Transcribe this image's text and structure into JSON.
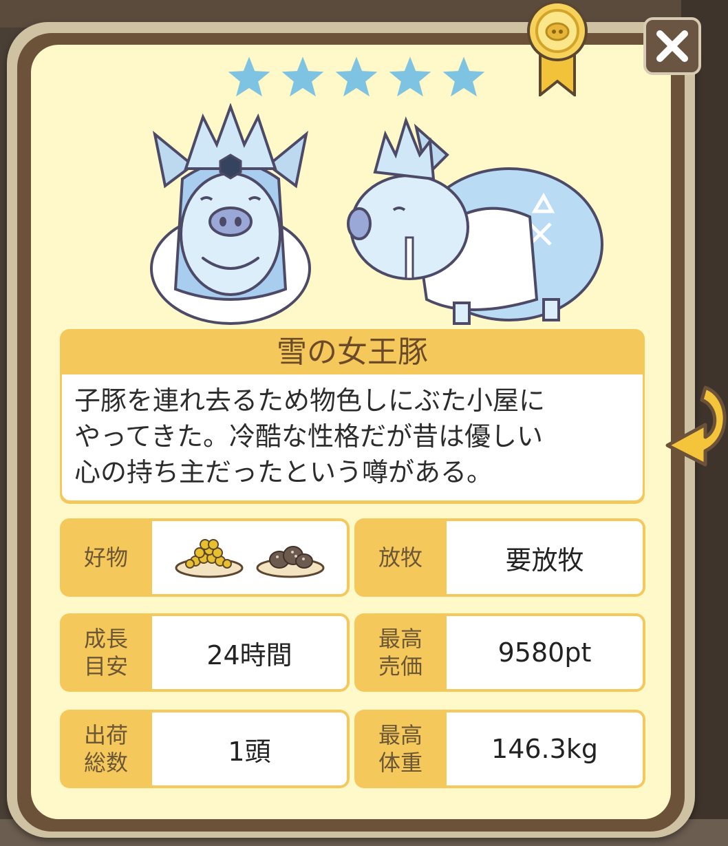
{
  "rarity_stars": 5,
  "pig": {
    "name": "雪の女王豚",
    "description_lines": [
      "子豚を連れ去るため物色しにぶた小屋に",
      "やってきた。冷酷な性格だが昔は優しい",
      "心の持ち主だったという噂がある。"
    ]
  },
  "stats": {
    "favorite": {
      "label": "好物",
      "items": [
        "corn-dish-icon",
        "dumpling-dish-icon"
      ]
    },
    "grazing": {
      "label": "放牧",
      "value": "要放牧"
    },
    "growth": {
      "label_lines": [
        "成長",
        "目安"
      ],
      "value": "24時間"
    },
    "max_price": {
      "label_lines": [
        "最高",
        "売価"
      ],
      "value": "9580pt"
    },
    "shipped": {
      "label_lines": [
        "出荷",
        "総数"
      ],
      "value": "1頭"
    },
    "max_weight": {
      "label_lines": [
        "最高",
        "体重"
      ],
      "value": "146.3kg"
    }
  },
  "colors": {
    "card_bg": "#fff8c8",
    "frame": "#6b5239",
    "accent_gold": "#f5c85c",
    "star_blue": "#7ec4e2",
    "label_text": "#6b5635"
  }
}
